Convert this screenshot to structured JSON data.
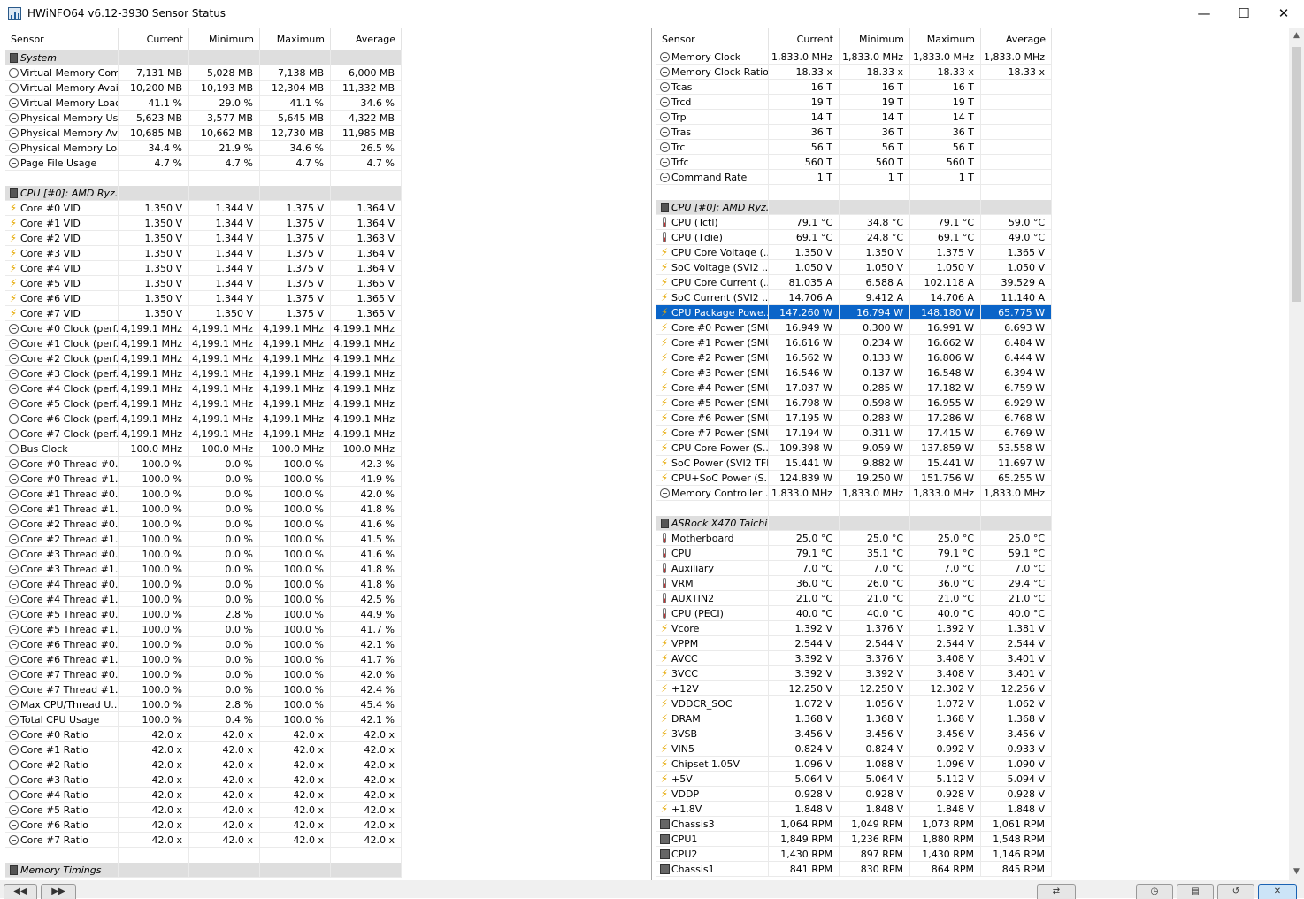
{
  "window": {
    "title": "HWiNFO64 v6.12-3930 Sensor Status",
    "minimize_glyph": "—",
    "maximize_glyph": "☐",
    "close_glyph": "✕"
  },
  "columns": [
    "Sensor",
    "Current",
    "Minimum",
    "Maximum",
    "Average"
  ],
  "left_rows": [
    {
      "type": "group",
      "label": "System"
    },
    {
      "icon": "circle",
      "name": "Virtual Memory Com...",
      "cur": "7,131 MB",
      "min": "5,028 MB",
      "max": "7,138 MB",
      "avg": "6,000 MB"
    },
    {
      "icon": "circle",
      "name": "Virtual Memory Avai...",
      "cur": "10,200 MB",
      "min": "10,193 MB",
      "max": "12,304 MB",
      "avg": "11,332 MB"
    },
    {
      "icon": "circle",
      "name": "Virtual Memory Load",
      "cur": "41.1 %",
      "min": "29.0 %",
      "max": "41.1 %",
      "avg": "34.6 %"
    },
    {
      "icon": "circle",
      "name": "Physical Memory Used",
      "cur": "5,623 MB",
      "min": "3,577 MB",
      "max": "5,645 MB",
      "avg": "4,322 MB"
    },
    {
      "icon": "circle",
      "name": "Physical Memory Av...",
      "cur": "10,685 MB",
      "min": "10,662 MB",
      "max": "12,730 MB",
      "avg": "11,985 MB"
    },
    {
      "icon": "circle",
      "name": "Physical Memory Load",
      "cur": "34.4 %",
      "min": "21.9 %",
      "max": "34.6 %",
      "avg": "26.5 %"
    },
    {
      "icon": "circle",
      "name": "Page File Usage",
      "cur": "4.7 %",
      "min": "4.7 %",
      "max": "4.7 %",
      "avg": "4.7 %"
    },
    {
      "type": "empty"
    },
    {
      "type": "group",
      "label": "CPU [#0]: AMD Ryz..."
    },
    {
      "icon": "bolt",
      "name": "Core #0 VID",
      "cur": "1.350 V",
      "min": "1.344 V",
      "max": "1.375 V",
      "avg": "1.364 V"
    },
    {
      "icon": "bolt",
      "name": "Core #1 VID",
      "cur": "1.350 V",
      "min": "1.344 V",
      "max": "1.375 V",
      "avg": "1.364 V"
    },
    {
      "icon": "bolt",
      "name": "Core #2 VID",
      "cur": "1.350 V",
      "min": "1.344 V",
      "max": "1.375 V",
      "avg": "1.363 V"
    },
    {
      "icon": "bolt",
      "name": "Core #3 VID",
      "cur": "1.350 V",
      "min": "1.344 V",
      "max": "1.375 V",
      "avg": "1.364 V"
    },
    {
      "icon": "bolt",
      "name": "Core #4 VID",
      "cur": "1.350 V",
      "min": "1.344 V",
      "max": "1.375 V",
      "avg": "1.364 V"
    },
    {
      "icon": "bolt",
      "name": "Core #5 VID",
      "cur": "1.350 V",
      "min": "1.344 V",
      "max": "1.375 V",
      "avg": "1.365 V"
    },
    {
      "icon": "bolt",
      "name": "Core #6 VID",
      "cur": "1.350 V",
      "min": "1.344 V",
      "max": "1.375 V",
      "avg": "1.365 V"
    },
    {
      "icon": "bolt",
      "name": "Core #7 VID",
      "cur": "1.350 V",
      "min": "1.350 V",
      "max": "1.375 V",
      "avg": "1.365 V"
    },
    {
      "icon": "circle",
      "name": "Core #0 Clock (perf...",
      "cur": "4,199.1 MHz",
      "min": "4,199.1 MHz",
      "max": "4,199.1 MHz",
      "avg": "4,199.1 MHz"
    },
    {
      "icon": "circle",
      "name": "Core #1 Clock (perf...",
      "cur": "4,199.1 MHz",
      "min": "4,199.1 MHz",
      "max": "4,199.1 MHz",
      "avg": "4,199.1 MHz"
    },
    {
      "icon": "circle",
      "name": "Core #2 Clock (perf...",
      "cur": "4,199.1 MHz",
      "min": "4,199.1 MHz",
      "max": "4,199.1 MHz",
      "avg": "4,199.1 MHz"
    },
    {
      "icon": "circle",
      "name": "Core #3 Clock (perf...",
      "cur": "4,199.1 MHz",
      "min": "4,199.1 MHz",
      "max": "4,199.1 MHz",
      "avg": "4,199.1 MHz"
    },
    {
      "icon": "circle",
      "name": "Core #4 Clock (perf...",
      "cur": "4,199.1 MHz",
      "min": "4,199.1 MHz",
      "max": "4,199.1 MHz",
      "avg": "4,199.1 MHz"
    },
    {
      "icon": "circle",
      "name": "Core #5 Clock (perf...",
      "cur": "4,199.1 MHz",
      "min": "4,199.1 MHz",
      "max": "4,199.1 MHz",
      "avg": "4,199.1 MHz"
    },
    {
      "icon": "circle",
      "name": "Core #6 Clock (perf...",
      "cur": "4,199.1 MHz",
      "min": "4,199.1 MHz",
      "max": "4,199.1 MHz",
      "avg": "4,199.1 MHz"
    },
    {
      "icon": "circle",
      "name": "Core #7 Clock (perf...",
      "cur": "4,199.1 MHz",
      "min": "4,199.1 MHz",
      "max": "4,199.1 MHz",
      "avg": "4,199.1 MHz"
    },
    {
      "icon": "circle",
      "name": "Bus Clock",
      "cur": "100.0 MHz",
      "min": "100.0 MHz",
      "max": "100.0 MHz",
      "avg": "100.0 MHz"
    },
    {
      "icon": "circle",
      "name": "Core #0 Thread #0...",
      "cur": "100.0 %",
      "min": "0.0 %",
      "max": "100.0 %",
      "avg": "42.3 %"
    },
    {
      "icon": "circle",
      "name": "Core #0 Thread #1...",
      "cur": "100.0 %",
      "min": "0.0 %",
      "max": "100.0 %",
      "avg": "41.9 %"
    },
    {
      "icon": "circle",
      "name": "Core #1 Thread #0...",
      "cur": "100.0 %",
      "min": "0.0 %",
      "max": "100.0 %",
      "avg": "42.0 %"
    },
    {
      "icon": "circle",
      "name": "Core #1 Thread #1...",
      "cur": "100.0 %",
      "min": "0.0 %",
      "max": "100.0 %",
      "avg": "41.8 %"
    },
    {
      "icon": "circle",
      "name": "Core #2 Thread #0...",
      "cur": "100.0 %",
      "min": "0.0 %",
      "max": "100.0 %",
      "avg": "41.6 %"
    },
    {
      "icon": "circle",
      "name": "Core #2 Thread #1...",
      "cur": "100.0 %",
      "min": "0.0 %",
      "max": "100.0 %",
      "avg": "41.5 %"
    },
    {
      "icon": "circle",
      "name": "Core #3 Thread #0...",
      "cur": "100.0 %",
      "min": "0.0 %",
      "max": "100.0 %",
      "avg": "41.6 %"
    },
    {
      "icon": "circle",
      "name": "Core #3 Thread #1...",
      "cur": "100.0 %",
      "min": "0.0 %",
      "max": "100.0 %",
      "avg": "41.8 %"
    },
    {
      "icon": "circle",
      "name": "Core #4 Thread #0...",
      "cur": "100.0 %",
      "min": "0.0 %",
      "max": "100.0 %",
      "avg": "41.8 %"
    },
    {
      "icon": "circle",
      "name": "Core #4 Thread #1...",
      "cur": "100.0 %",
      "min": "0.0 %",
      "max": "100.0 %",
      "avg": "42.5 %"
    },
    {
      "icon": "circle",
      "name": "Core #5 Thread #0...",
      "cur": "100.0 %",
      "min": "2.8 %",
      "max": "100.0 %",
      "avg": "44.9 %"
    },
    {
      "icon": "circle",
      "name": "Core #5 Thread #1...",
      "cur": "100.0 %",
      "min": "0.0 %",
      "max": "100.0 %",
      "avg": "41.7 %"
    },
    {
      "icon": "circle",
      "name": "Core #6 Thread #0...",
      "cur": "100.0 %",
      "min": "0.0 %",
      "max": "100.0 %",
      "avg": "42.1 %"
    },
    {
      "icon": "circle",
      "name": "Core #6 Thread #1...",
      "cur": "100.0 %",
      "min": "0.0 %",
      "max": "100.0 %",
      "avg": "41.7 %"
    },
    {
      "icon": "circle",
      "name": "Core #7 Thread #0...",
      "cur": "100.0 %",
      "min": "0.0 %",
      "max": "100.0 %",
      "avg": "42.0 %"
    },
    {
      "icon": "circle",
      "name": "Core #7 Thread #1...",
      "cur": "100.0 %",
      "min": "0.0 %",
      "max": "100.0 %",
      "avg": "42.4 %"
    },
    {
      "icon": "circle",
      "name": "Max CPU/Thread U...",
      "cur": "100.0 %",
      "min": "2.8 %",
      "max": "100.0 %",
      "avg": "45.4 %"
    },
    {
      "icon": "circle",
      "name": "Total CPU Usage",
      "cur": "100.0 %",
      "min": "0.4 %",
      "max": "100.0 %",
      "avg": "42.1 %"
    },
    {
      "icon": "circle",
      "name": "Core #0 Ratio",
      "cur": "42.0 x",
      "min": "42.0 x",
      "max": "42.0 x",
      "avg": "42.0 x"
    },
    {
      "icon": "circle",
      "name": "Core #1 Ratio",
      "cur": "42.0 x",
      "min": "42.0 x",
      "max": "42.0 x",
      "avg": "42.0 x"
    },
    {
      "icon": "circle",
      "name": "Core #2 Ratio",
      "cur": "42.0 x",
      "min": "42.0 x",
      "max": "42.0 x",
      "avg": "42.0 x"
    },
    {
      "icon": "circle",
      "name": "Core #3 Ratio",
      "cur": "42.0 x",
      "min": "42.0 x",
      "max": "42.0 x",
      "avg": "42.0 x"
    },
    {
      "icon": "circle",
      "name": "Core #4 Ratio",
      "cur": "42.0 x",
      "min": "42.0 x",
      "max": "42.0 x",
      "avg": "42.0 x"
    },
    {
      "icon": "circle",
      "name": "Core #5 Ratio",
      "cur": "42.0 x",
      "min": "42.0 x",
      "max": "42.0 x",
      "avg": "42.0 x"
    },
    {
      "icon": "circle",
      "name": "Core #6 Ratio",
      "cur": "42.0 x",
      "min": "42.0 x",
      "max": "42.0 x",
      "avg": "42.0 x"
    },
    {
      "icon": "circle",
      "name": "Core #7 Ratio",
      "cur": "42.0 x",
      "min": "42.0 x",
      "max": "42.0 x",
      "avg": "42.0 x"
    },
    {
      "type": "empty"
    },
    {
      "type": "group",
      "label": "Memory Timings"
    }
  ],
  "right_rows": [
    {
      "icon": "circle",
      "name": "Memory Clock",
      "cur": "1,833.0 MHz",
      "min": "1,833.0 MHz",
      "max": "1,833.0 MHz",
      "avg": "1,833.0 MHz"
    },
    {
      "icon": "circle",
      "name": "Memory Clock Ratio",
      "cur": "18.33 x",
      "min": "18.33 x",
      "max": "18.33 x",
      "avg": "18.33 x"
    },
    {
      "icon": "circle",
      "name": "Tcas",
      "cur": "16 T",
      "min": "16 T",
      "max": "16 T",
      "avg": ""
    },
    {
      "icon": "circle",
      "name": "Trcd",
      "cur": "19 T",
      "min": "19 T",
      "max": "19 T",
      "avg": ""
    },
    {
      "icon": "circle",
      "name": "Trp",
      "cur": "14 T",
      "min": "14 T",
      "max": "14 T",
      "avg": ""
    },
    {
      "icon": "circle",
      "name": "Tras",
      "cur": "36 T",
      "min": "36 T",
      "max": "36 T",
      "avg": ""
    },
    {
      "icon": "circle",
      "name": "Trc",
      "cur": "56 T",
      "min": "56 T",
      "max": "56 T",
      "avg": ""
    },
    {
      "icon": "circle",
      "name": "Trfc",
      "cur": "560 T",
      "min": "560 T",
      "max": "560 T",
      "avg": ""
    },
    {
      "icon": "circle",
      "name": "Command Rate",
      "cur": "1 T",
      "min": "1 T",
      "max": "1 T",
      "avg": ""
    },
    {
      "type": "empty"
    },
    {
      "type": "group",
      "label": "CPU [#0]: AMD Ryz..."
    },
    {
      "icon": "therm",
      "name": "CPU (Tctl)",
      "cur": "79.1 °C",
      "min": "34.8 °C",
      "max": "79.1 °C",
      "avg": "59.0 °C"
    },
    {
      "icon": "therm",
      "name": "CPU (Tdie)",
      "cur": "69.1 °C",
      "min": "24.8 °C",
      "max": "69.1 °C",
      "avg": "49.0 °C"
    },
    {
      "icon": "bolt",
      "name": "CPU Core Voltage (...",
      "cur": "1.350 V",
      "min": "1.350 V",
      "max": "1.375 V",
      "avg": "1.365 V"
    },
    {
      "icon": "bolt",
      "name": "SoC Voltage (SVI2 ...",
      "cur": "1.050 V",
      "min": "1.050 V",
      "max": "1.050 V",
      "avg": "1.050 V"
    },
    {
      "icon": "bolt",
      "name": "CPU Core Current (...",
      "cur": "81.035 A",
      "min": "6.588 A",
      "max": "102.118 A",
      "avg": "39.529 A"
    },
    {
      "icon": "bolt",
      "name": "SoC Current (SVI2 ...",
      "cur": "14.706 A",
      "min": "9.412 A",
      "max": "14.706 A",
      "avg": "11.140 A"
    },
    {
      "icon": "bolt",
      "name": "CPU Package Powe...",
      "cur": "147.260 W",
      "min": "16.794 W",
      "max": "148.180 W",
      "avg": "65.775 W",
      "selected": true
    },
    {
      "icon": "bolt",
      "name": "Core #0 Power (SMU)",
      "cur": "16.949 W",
      "min": "0.300 W",
      "max": "16.991 W",
      "avg": "6.693 W"
    },
    {
      "icon": "bolt",
      "name": "Core #1 Power (SMU)",
      "cur": "16.616 W",
      "min": "0.234 W",
      "max": "16.662 W",
      "avg": "6.484 W"
    },
    {
      "icon": "bolt",
      "name": "Core #2 Power (SMU)",
      "cur": "16.562 W",
      "min": "0.133 W",
      "max": "16.806 W",
      "avg": "6.444 W"
    },
    {
      "icon": "bolt",
      "name": "Core #3 Power (SMU)",
      "cur": "16.546 W",
      "min": "0.137 W",
      "max": "16.548 W",
      "avg": "6.394 W"
    },
    {
      "icon": "bolt",
      "name": "Core #4 Power (SMU)",
      "cur": "17.037 W",
      "min": "0.285 W",
      "max": "17.182 W",
      "avg": "6.759 W"
    },
    {
      "icon": "bolt",
      "name": "Core #5 Power (SMU)",
      "cur": "16.798 W",
      "min": "0.598 W",
      "max": "16.955 W",
      "avg": "6.929 W"
    },
    {
      "icon": "bolt",
      "name": "Core #6 Power (SMU)",
      "cur": "17.195 W",
      "min": "0.283 W",
      "max": "17.286 W",
      "avg": "6.768 W"
    },
    {
      "icon": "bolt",
      "name": "Core #7 Power (SMU)",
      "cur": "17.194 W",
      "min": "0.311 W",
      "max": "17.415 W",
      "avg": "6.769 W"
    },
    {
      "icon": "bolt",
      "name": "CPU Core Power (S...",
      "cur": "109.398 W",
      "min": "9.059 W",
      "max": "137.859 W",
      "avg": "53.558 W"
    },
    {
      "icon": "bolt",
      "name": "SoC Power (SVI2 TFN)",
      "cur": "15.441 W",
      "min": "9.882 W",
      "max": "15.441 W",
      "avg": "11.697 W"
    },
    {
      "icon": "bolt",
      "name": "CPU+SoC Power (S...",
      "cur": "124.839 W",
      "min": "19.250 W",
      "max": "151.756 W",
      "avg": "65.255 W"
    },
    {
      "icon": "circle",
      "name": "Memory Controller ...",
      "cur": "1,833.0 MHz",
      "min": "1,833.0 MHz",
      "max": "1,833.0 MHz",
      "avg": "1,833.0 MHz"
    },
    {
      "type": "empty"
    },
    {
      "type": "group",
      "label": "ASRock X470 Taichi..."
    },
    {
      "icon": "therm",
      "name": "Motherboard",
      "cur": "25.0 °C",
      "min": "25.0 °C",
      "max": "25.0 °C",
      "avg": "25.0 °C"
    },
    {
      "icon": "therm",
      "name": "CPU",
      "cur": "79.1 °C",
      "min": "35.1 °C",
      "max": "79.1 °C",
      "avg": "59.1 °C"
    },
    {
      "icon": "therm",
      "name": "Auxiliary",
      "cur": "7.0 °C",
      "min": "7.0 °C",
      "max": "7.0 °C",
      "avg": "7.0 °C"
    },
    {
      "icon": "therm",
      "name": "VRM",
      "cur": "36.0 °C",
      "min": "26.0 °C",
      "max": "36.0 °C",
      "avg": "29.4 °C"
    },
    {
      "icon": "therm",
      "name": "AUXTIN2",
      "cur": "21.0 °C",
      "min": "21.0 °C",
      "max": "21.0 °C",
      "avg": "21.0 °C"
    },
    {
      "icon": "therm",
      "name": "CPU (PECI)",
      "cur": "40.0 °C",
      "min": "40.0 °C",
      "max": "40.0 °C",
      "avg": "40.0 °C"
    },
    {
      "icon": "bolt",
      "name": "Vcore",
      "cur": "1.392 V",
      "min": "1.376 V",
      "max": "1.392 V",
      "avg": "1.381 V"
    },
    {
      "icon": "bolt",
      "name": "VPPM",
      "cur": "2.544 V",
      "min": "2.544 V",
      "max": "2.544 V",
      "avg": "2.544 V"
    },
    {
      "icon": "bolt",
      "name": "AVCC",
      "cur": "3.392 V",
      "min": "3.376 V",
      "max": "3.408 V",
      "avg": "3.401 V"
    },
    {
      "icon": "bolt",
      "name": "3VCC",
      "cur": "3.392 V",
      "min": "3.392 V",
      "max": "3.408 V",
      "avg": "3.401 V"
    },
    {
      "icon": "bolt",
      "name": "+12V",
      "cur": "12.250 V",
      "min": "12.250 V",
      "max": "12.302 V",
      "avg": "12.256 V"
    },
    {
      "icon": "bolt",
      "name": "VDDCR_SOC",
      "cur": "1.072 V",
      "min": "1.056 V",
      "max": "1.072 V",
      "avg": "1.062 V"
    },
    {
      "icon": "bolt",
      "name": "DRAM",
      "cur": "1.368 V",
      "min": "1.368 V",
      "max": "1.368 V",
      "avg": "1.368 V"
    },
    {
      "icon": "bolt",
      "name": "3VSB",
      "cur": "3.456 V",
      "min": "3.456 V",
      "max": "3.456 V",
      "avg": "3.456 V"
    },
    {
      "icon": "bolt",
      "name": "VIN5",
      "cur": "0.824 V",
      "min": "0.824 V",
      "max": "0.992 V",
      "avg": "0.933 V"
    },
    {
      "icon": "bolt",
      "name": "Chipset 1.05V",
      "cur": "1.096 V",
      "min": "1.088 V",
      "max": "1.096 V",
      "avg": "1.090 V"
    },
    {
      "icon": "bolt",
      "name": "+5V",
      "cur": "5.064 V",
      "min": "5.064 V",
      "max": "5.112 V",
      "avg": "5.094 V"
    },
    {
      "icon": "bolt",
      "name": "VDDP",
      "cur": "0.928 V",
      "min": "0.928 V",
      "max": "0.928 V",
      "avg": "0.928 V"
    },
    {
      "icon": "bolt",
      "name": "+1.8V",
      "cur": "1.848 V",
      "min": "1.848 V",
      "max": "1.848 V",
      "avg": "1.848 V"
    },
    {
      "icon": "fan",
      "name": "Chassis3",
      "cur": "1,064 RPM",
      "min": "1,049 RPM",
      "max": "1,073 RPM",
      "avg": "1,061 RPM"
    },
    {
      "icon": "fan",
      "name": "CPU1",
      "cur": "1,849 RPM",
      "min": "1,236 RPM",
      "max": "1,880 RPM",
      "avg": "1,548 RPM"
    },
    {
      "icon": "fan",
      "name": "CPU2",
      "cur": "1,430 RPM",
      "min": "897 RPM",
      "max": "1,430 RPM",
      "avg": "1,146 RPM"
    },
    {
      "icon": "fan",
      "name": "Chassis1",
      "cur": "841 RPM",
      "min": "830 RPM",
      "max": "864 RPM",
      "avg": "845 RPM"
    }
  ],
  "scrollbar": {
    "up_glyph": "▲",
    "down_glyph": "▼"
  },
  "statusbar": {
    "buttons": [
      {
        "name": "nav-left-button",
        "glyph": "◀◀"
      },
      {
        "name": "nav-right-button",
        "glyph": "▶▶"
      },
      {
        "name": "network-button",
        "glyph": "⇄"
      },
      {
        "name": "clock-button",
        "glyph": "◷"
      },
      {
        "name": "report-button",
        "glyph": "▤"
      },
      {
        "name": "reset-button",
        "glyph": "↺"
      },
      {
        "name": "layout-button",
        "glyph": "✕",
        "active": true
      }
    ]
  }
}
